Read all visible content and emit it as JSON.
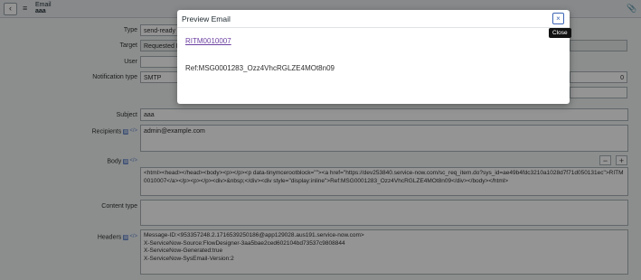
{
  "header": {
    "back_icon": "‹",
    "menu_icon": "≡",
    "title": "Email",
    "subtitle": "aaa",
    "attachment_icon": "📎"
  },
  "form": {
    "type": {
      "label": "Type",
      "value": "send-ready"
    },
    "target": {
      "label": "Target",
      "value": "Requested It"
    },
    "user": {
      "label": "User",
      "value": ""
    },
    "notification_type": {
      "label": "Notification type",
      "value": "SMTP",
      "right_value": "0"
    },
    "subject": {
      "label": "Subject",
      "value": "aaa"
    },
    "recipients": {
      "label": "Recipients",
      "value": "admin@example.com"
    },
    "body": {
      "label": "Body",
      "value": "<html><head></head><body><p></p><p data-tinymcerootblock=\"\"><a href=\"https://dev253840.service-now.com/sc_req_item.do?sys_id=ae49b4fdc3210a1028d7f71d050131ec\">RITM0010007</a></p><p></p><div>&nbsp;</div><div style=\"display:inline\">Ref:MSG0001283_Ozz4VhcRGLZE4MOt8n09</div></body></html>",
      "minus_label": "−",
      "plus_label": "+"
    },
    "content_type": {
      "label": "Content type",
      "value": ""
    },
    "headers": {
      "label": "Headers",
      "value": "Message-ID:<953357248.2.1716539250186@app129028.aus191.service-now.com>\nX-ServiceNow-Source:FlowDesigner-3aa5bae2ced602104bd73537c9808844\nX-ServiceNow-Generated:true\nX-ServiceNow-SysEmail-Version:2"
    }
  },
  "modal": {
    "title": "Preview Email",
    "close_icon": "×",
    "close_tooltip": "Close",
    "link_text": "RITM0010007",
    "ref_text": "Ref:MSG0001283_Ozz4VhcRGLZE4MOt8n09"
  }
}
